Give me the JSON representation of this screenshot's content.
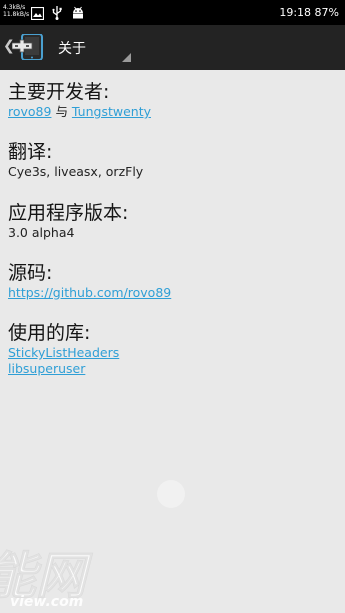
{
  "status_bar": {
    "net_speed_up": "4.3kB/s",
    "net_speed_down": "11.8kB/s",
    "time": "19:18",
    "battery": "87%",
    "icons": [
      "image-icon",
      "usb-icon",
      "android-icon",
      "wifi-icon",
      "signal-icon",
      "battery-icon"
    ]
  },
  "action_bar": {
    "title": "关于",
    "back_icon": "chevron-left-icon",
    "logo_icon": "app-logo-icon"
  },
  "sections": {
    "developers": {
      "heading": "主要开发者:",
      "link1": "rovo89",
      "separator": " 与 ",
      "link2": "Tungstwenty"
    },
    "translation": {
      "heading": "翻译:",
      "text": "Cye3s, liveasx, orzFly"
    },
    "version": {
      "heading": "应用程序版本:",
      "text": "3.0 alpha4"
    },
    "source": {
      "heading": "源码:",
      "link": "https://github.com/rovo89"
    },
    "libraries": {
      "heading": "使用的库:",
      "items": [
        "StickyListHeaders",
        "libsuperuser"
      ]
    }
  },
  "watermark": {
    "main": "能网",
    "sub": "view.com"
  },
  "colors": {
    "link": "#2f9fd6",
    "action_bar": "#232323",
    "background": "#e9e9e9"
  }
}
